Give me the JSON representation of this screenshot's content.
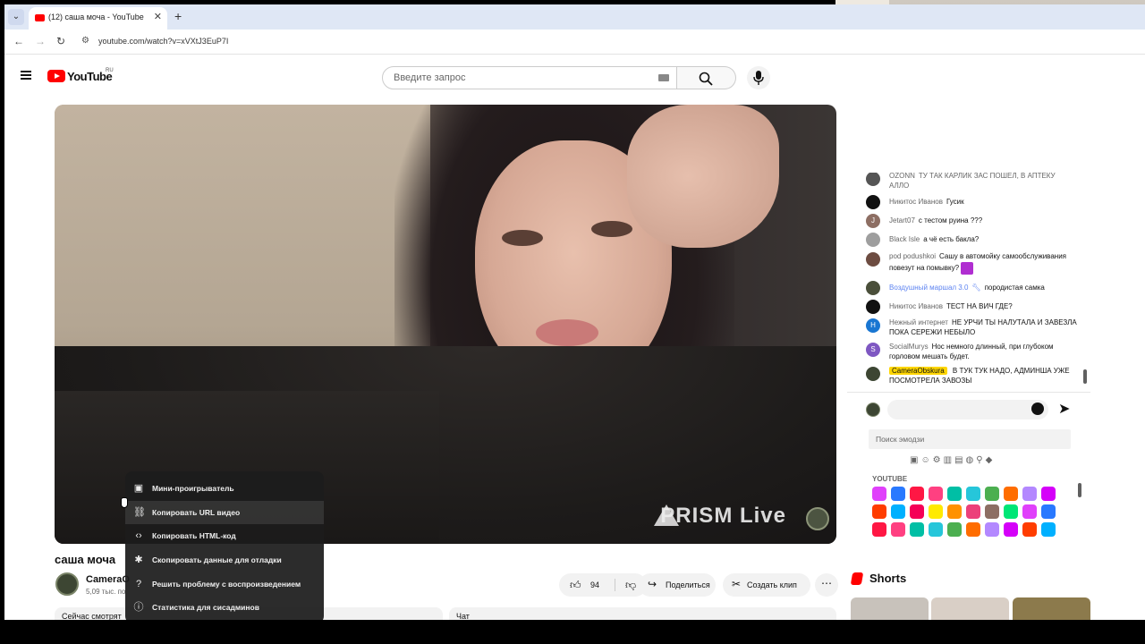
{
  "browser": {
    "tab_title": "(12) саша моча - YouTube",
    "url": "youtube.com/watch?v=xVXtJ3EuP7I"
  },
  "youtube": {
    "wordmark": "YouTube",
    "region": "RU",
    "search_placeholder": "Введите запрос"
  },
  "video": {
    "title": "саша моча",
    "overlay_text": "PRISM Live",
    "channel_name": "CameraO",
    "subscribers": "5,09 тыс. по"
  },
  "context_menu": {
    "items": [
      {
        "icon": "miniplayer-icon",
        "label": "Мини-проигрыватель"
      },
      {
        "icon": "link-icon",
        "label": "Копировать URL видео"
      },
      {
        "icon": "code-icon",
        "label": "Копировать HTML-код"
      },
      {
        "icon": "bug-icon",
        "label": "Скопировать данные для отладки"
      },
      {
        "icon": "help-icon",
        "label": "Решить проблему с воспроизведением"
      },
      {
        "icon": "info-icon",
        "label": "Статистика для сисадминов"
      }
    ]
  },
  "actions": {
    "like_count": "94",
    "share_label": "Поделиться",
    "clip_label": "Создать клип",
    "more_label": "⋯"
  },
  "panels": {
    "now_watching": "Сейчас смотрят",
    "chat": "Чат"
  },
  "chat": {
    "messages": [
      {
        "author": "OZONN",
        "text": "ТУ ТАК КАРЛИК ЗАС ПОШЕЛ, В АПТЕКУ АЛЛО",
        "avatar_color": "#555555"
      },
      {
        "author": "Никитос Иванов",
        "text": "Гусик",
        "avatar_color": "#111111"
      },
      {
        "author": "Jetart07",
        "text": "с тестом руина ???",
        "avatar_color": "#8d6e63",
        "avatar_letter": "J"
      },
      {
        "author": "Black Isle",
        "text": "а чё есть бакла?",
        "avatar_color": "#9e9e9e"
      },
      {
        "author": "pod podushkoi",
        "text": "Сашу в автомойку самообслуживания повезут на помывку?",
        "avatar_color": "#6d4c41"
      },
      {
        "author": "Воздушный маршал 3.0",
        "text": "породистая самка",
        "avatar_color": "#4a4f3a"
      },
      {
        "author": "Никитос Иванов",
        "text": "ТЕСТ НА ВИЧ ГДЕ?",
        "avatar_color": "#111111"
      },
      {
        "author": "Нежный интернет",
        "text": "НЕ УРЧИ ТЫ НАЛУТАЛА И ЗАВЕЗЛА ПОКА СЕРЕЖИ НЕБЫЛО",
        "avatar_color": "#1976d2",
        "avatar_letter": "Н"
      },
      {
        "author": "SocialMurys",
        "text": "Нос немного длинный, при глубоком горловом мешать будет.",
        "avatar_color": "#7e57c2",
        "avatar_letter": "S"
      },
      {
        "author": "CameraObskura",
        "text": "В ТУК ТУК НАДО, АДМИНША УЖЕ ПОСМОТРЕЛА ЗАВОЗЫ",
        "avatar_color": "#3d4633"
      }
    ],
    "emoji_search_placeholder": "Поиск эмодзи",
    "emoji_section": "YOUTUBE",
    "emoji_categories": "▣☺⚙▥▤◍⚲◆"
  },
  "shorts": {
    "title": "Shorts"
  },
  "colors": {
    "yt_red": "#ff0000",
    "member_badge": "#ffd600",
    "moderator_name": "#5e84f1"
  }
}
